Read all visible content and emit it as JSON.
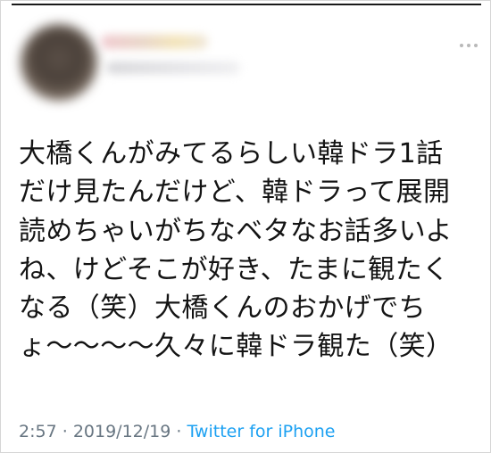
{
  "tweet": {
    "text": "大橋くんがみてるらしい韓ドラ1話\nだけ見たんだけど、韓ドラって展開\n読めちゃいがちなベタなお話多いよ\nね、けどそこが好き、たまに観たく\nなる（笑）大橋くんのおかげでち\nょ〜〜〜〜久々に韓ドラ観た（笑）",
    "time": "2:57",
    "date": "2019/12/19",
    "separator": "·",
    "source": "Twitter for iPhone"
  },
  "icons": {
    "more": "more-options-icon"
  },
  "colors": {
    "text": "#141414",
    "meta": "#687682",
    "link": "#1da1f2"
  }
}
